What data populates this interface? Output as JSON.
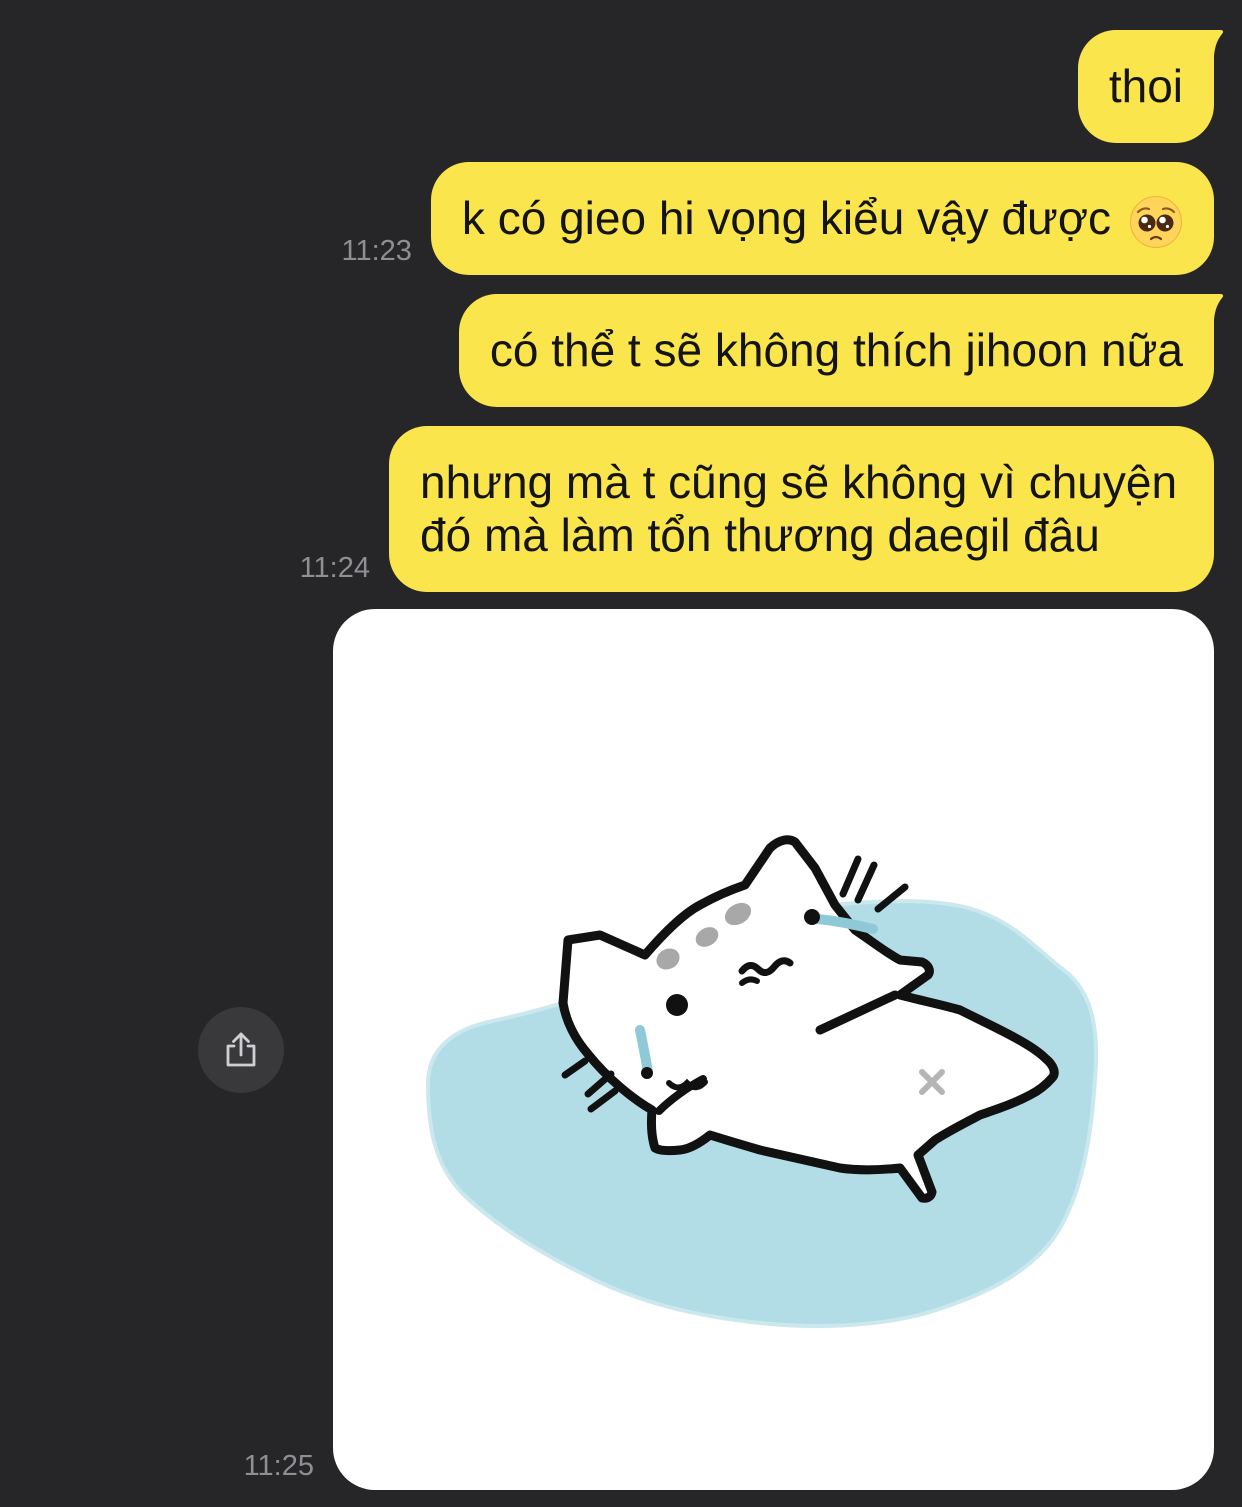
{
  "colors": {
    "background": "#262628",
    "my_bubble": "#FAE54C",
    "timestamp": "#8E8E93",
    "share_button": "#39393B"
  },
  "chat": {
    "messages": [
      {
        "text": "thoi"
      },
      {
        "text": "k có gieo hi vọng kiểu vậy được",
        "emoji_icon": "pleading-face-icon",
        "time": "11:23"
      },
      {
        "text": "có thể t sẽ không thích jihoon nữa"
      },
      {
        "text": "nhưng mà t cũng sẽ không vì chuyện đó mà làm tổn thương daegil đâu",
        "time": "11:24"
      },
      {
        "image_icon": "cat-sticker-icon",
        "time": "11:25"
      }
    ]
  },
  "share_button": {
    "icon": "share-icon"
  }
}
